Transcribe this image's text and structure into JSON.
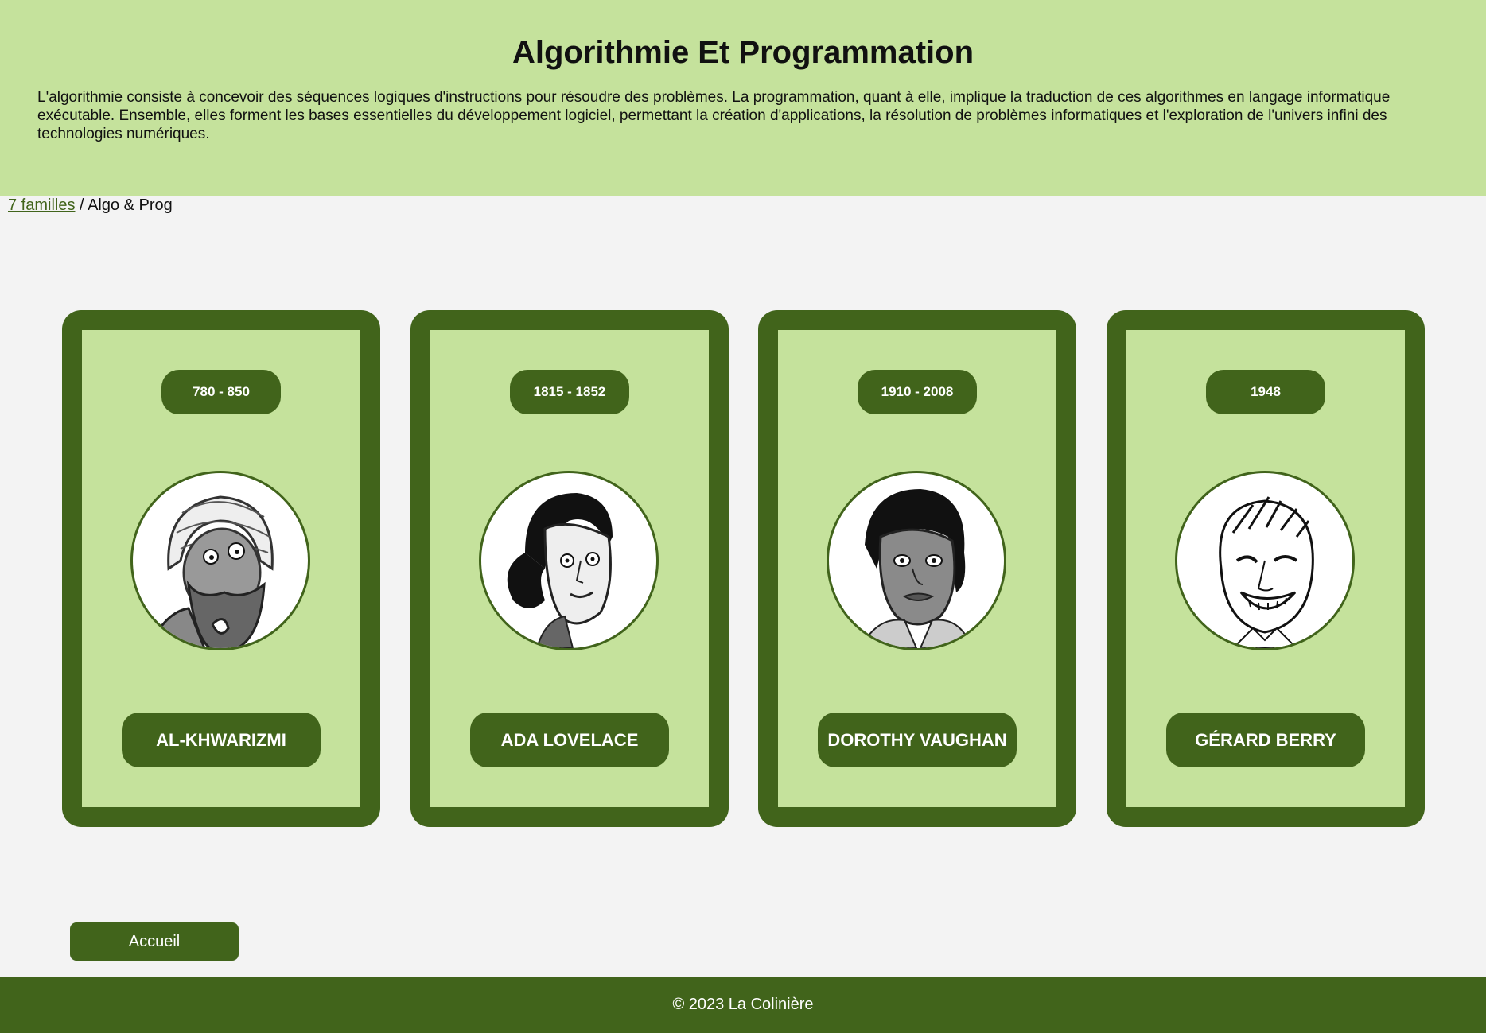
{
  "header": {
    "title": "Algorithmie Et Programmation",
    "description": "L'algorithmie consiste à concevoir des séquences logiques d'instructions pour résoudre des problèmes. La programmation, quant à elle, implique la traduction de ces algorithmes en langage informatique exécutable. Ensemble, elles forment les bases essentielles du développement logiciel, permettant la création d'applications, la résolution de problèmes informatiques et l'exploration de l'univers infini des technologies numériques."
  },
  "breadcrumb": {
    "link_label": "7 familles",
    "separator": " / ",
    "current": "Algo & Prog"
  },
  "cards": [
    {
      "dates": "780 - 850",
      "name": "AL-KHWARIZMI",
      "portrait_icon": "al-khwarizmi-portrait"
    },
    {
      "dates": "1815 - 1852",
      "name": "ADA LOVELACE",
      "portrait_icon": "ada-lovelace-portrait"
    },
    {
      "dates": "1910 - 2008",
      "name": "DOROTHY VAUGHAN",
      "portrait_icon": "dorothy-vaughan-portrait"
    },
    {
      "dates": "1948",
      "name": "GÉRARD BERRY",
      "portrait_icon": "gerard-berry-portrait"
    }
  ],
  "home_button": {
    "label": "Accueil"
  },
  "footer": {
    "text": "© 2023 La Colinière"
  },
  "colors": {
    "dark_green": "#41641b",
    "light_green": "#c5e29c",
    "background": "#f3f3f3"
  }
}
